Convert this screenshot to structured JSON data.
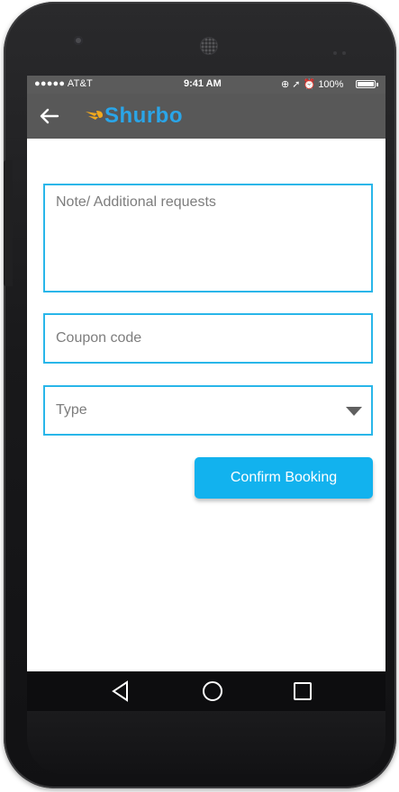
{
  "status_bar": {
    "carrier": "●●●●● AT&T",
    "time": "9:41 AM",
    "battery": "100%"
  },
  "app_bar": {
    "logo_text": "Shurbo"
  },
  "form": {
    "note_placeholder": "Note/ Additional requests",
    "coupon_placeholder": "Coupon code",
    "type_placeholder": "Type",
    "confirm_label": "Confirm Booking"
  },
  "icons": {
    "back": "arrow-left-icon",
    "dropdown": "triangle-down-icon",
    "nav_back": "nav-back-icon",
    "nav_home": "nav-home-icon",
    "nav_recents": "nav-recents-icon"
  },
  "colors": {
    "accent": "#29b6e9",
    "button": "#12b2ee",
    "appbar": "#585858"
  }
}
